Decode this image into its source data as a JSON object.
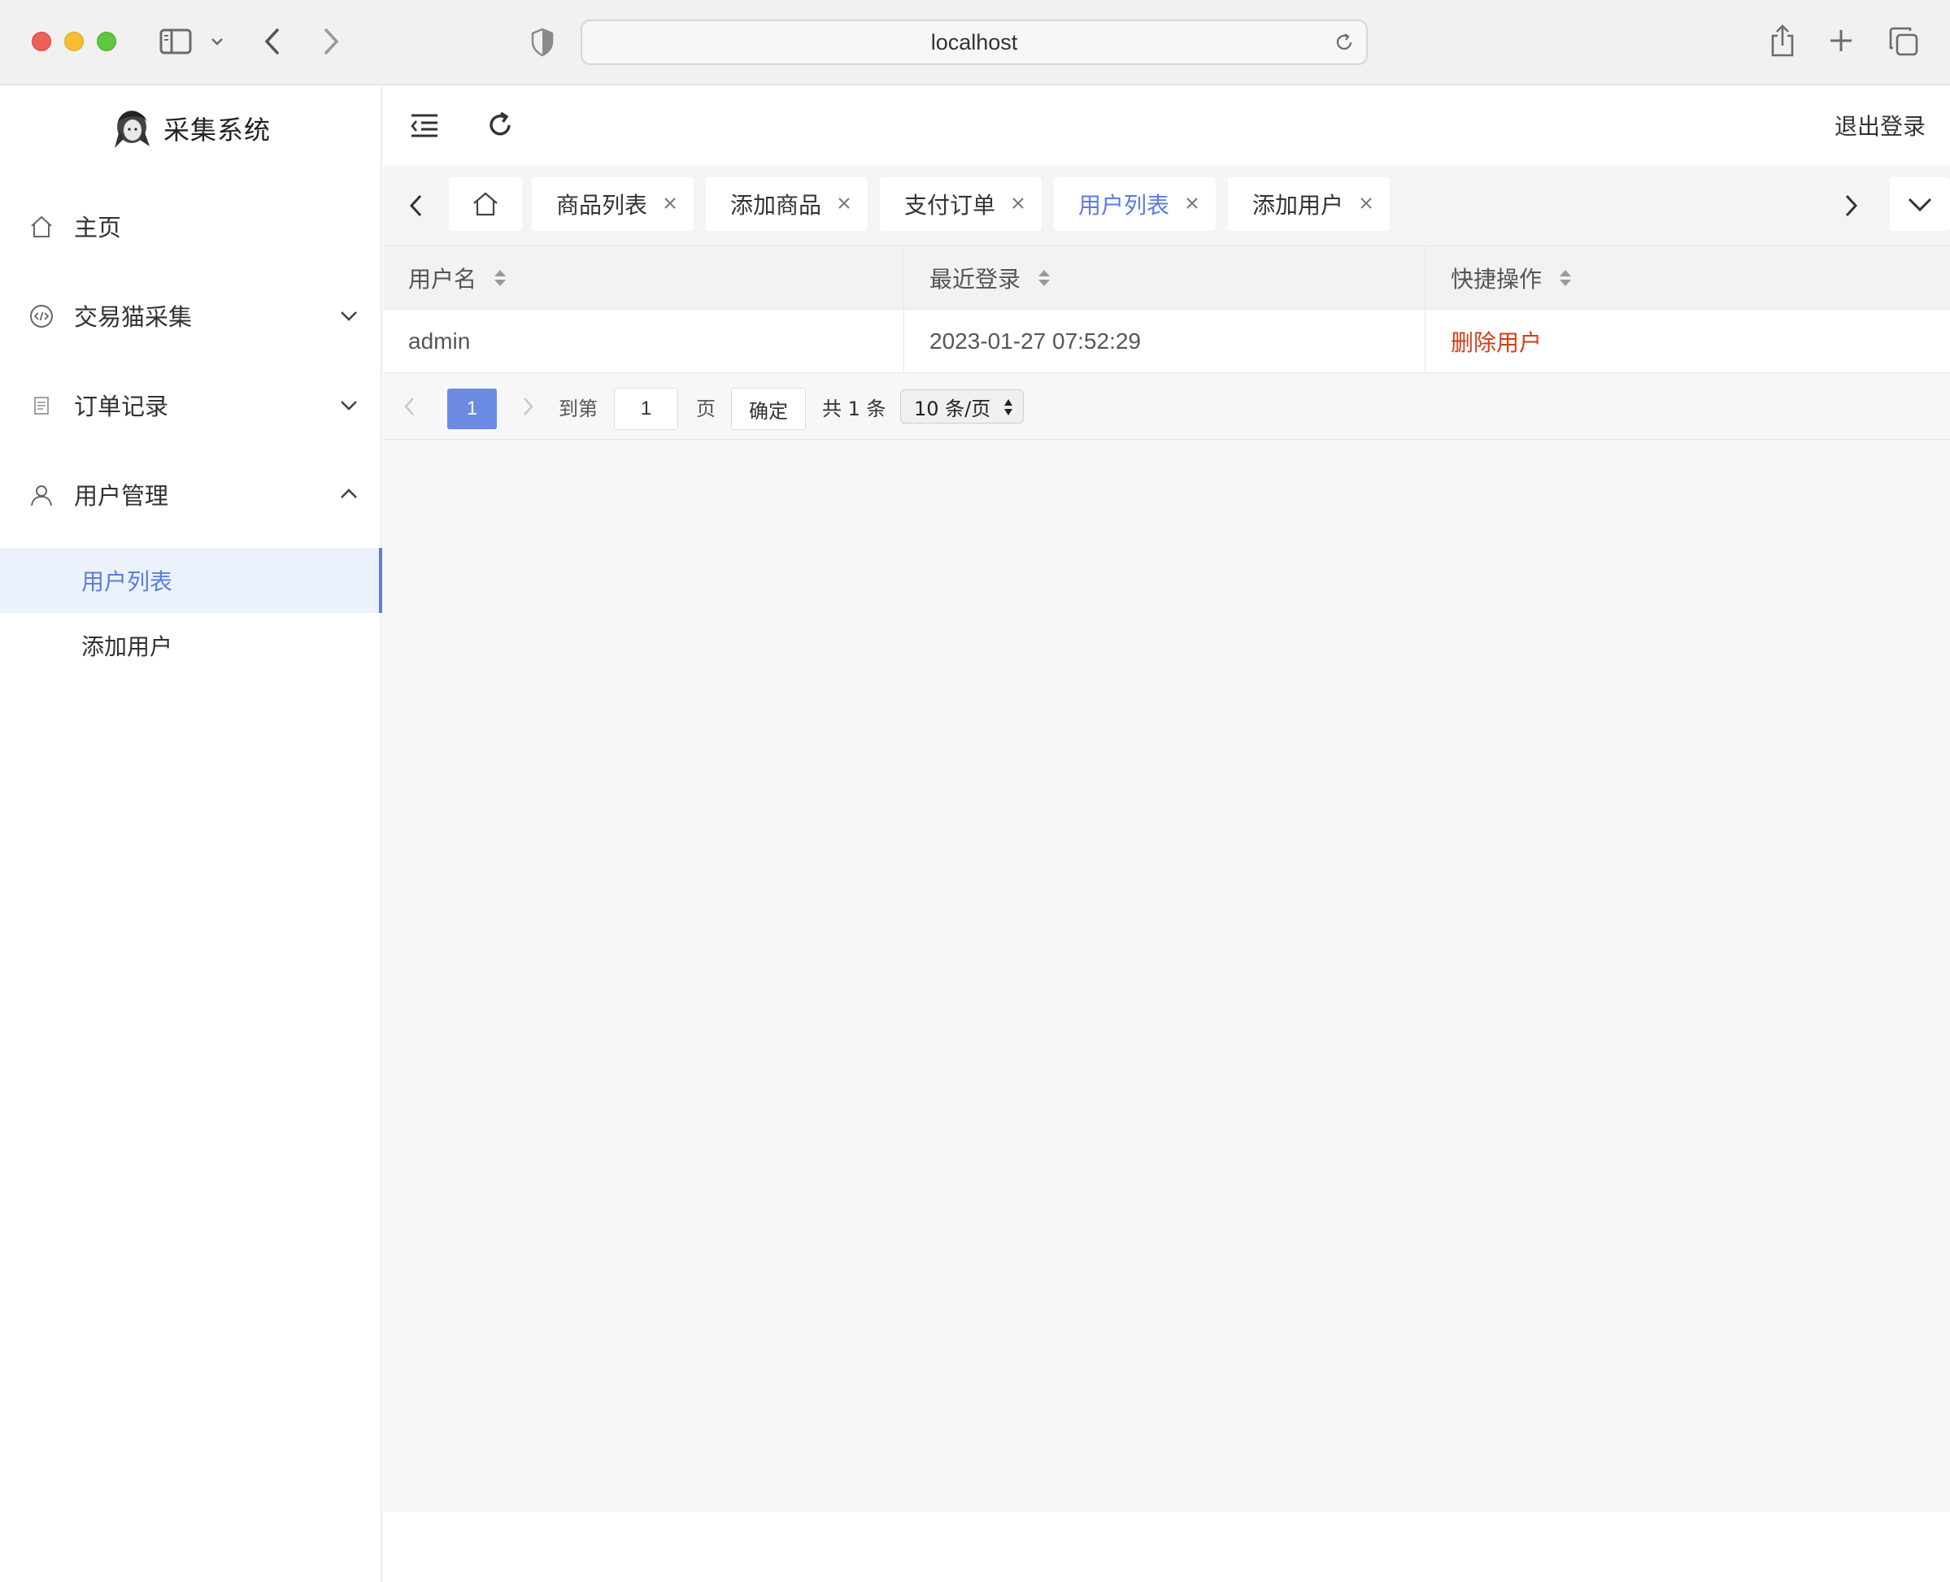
{
  "browser": {
    "address": "localhost"
  },
  "app": {
    "brand_title": "采集系统",
    "logout_label": "退出登录"
  },
  "sidebar": {
    "items": [
      {
        "label": "主页"
      },
      {
        "label": "交易猫采集"
      },
      {
        "label": "订单记录"
      },
      {
        "label": "用户管理"
      }
    ],
    "sub_items": [
      {
        "label": "用户列表"
      },
      {
        "label": "添加用户"
      }
    ]
  },
  "tabs": [
    {
      "label": "商品列表"
    },
    {
      "label": "添加商品"
    },
    {
      "label": "支付订单"
    },
    {
      "label": "用户列表"
    },
    {
      "label": "添加用户"
    }
  ],
  "table": {
    "columns": [
      "用户名",
      "最近登录",
      "快捷操作"
    ],
    "rows": [
      {
        "username": "admin",
        "last_login": "2023-01-27 07:52:29",
        "action": "删除用户"
      }
    ]
  },
  "pagination": {
    "current_page": "1",
    "goto_label": "到第",
    "goto_value": "1",
    "page_unit": "页",
    "confirm_label": "确定",
    "total_label": "共 1 条",
    "page_size": "10 条/页"
  },
  "colors": {
    "accent": "#5b7ce0",
    "danger": "#d33f1a"
  }
}
